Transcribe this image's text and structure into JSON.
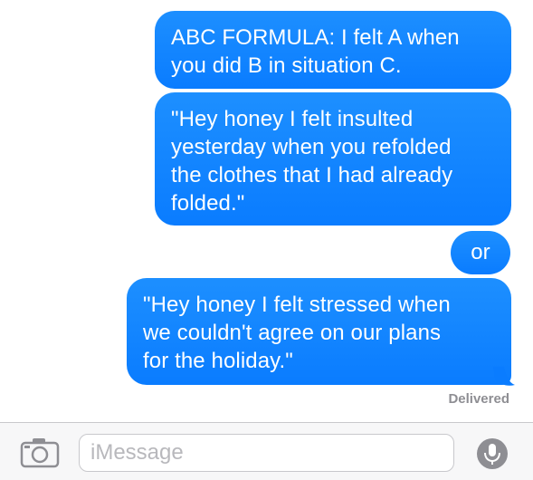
{
  "messages": [
    "ABC FORMULA: I felt A when\nyou did B in situation C.",
    "\"Hey honey I felt insulted\nyesterday when you refolded\nthe clothes that I had already\nfolded.\"",
    "or",
    "\"Hey honey I felt stressed when\nwe couldn't agree on our plans\nfor the holiday.\""
  ],
  "status": "Delivered",
  "composer": {
    "placeholder": "iMessage",
    "camera_icon": "camera-icon",
    "mic_icon": "microphone-icon"
  },
  "colors": {
    "bubble": "#1a8cff",
    "status_text": "#8e8e93",
    "bar_background": "#f7f7f8"
  }
}
